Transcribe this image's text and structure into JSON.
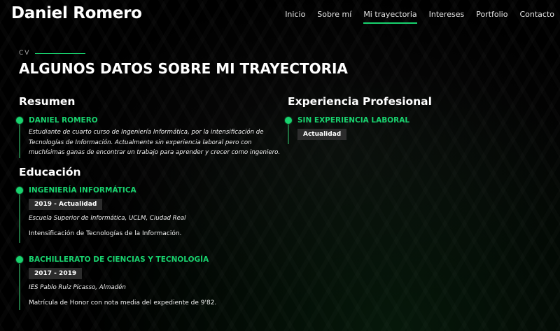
{
  "header": {
    "logo": "Daniel Romero",
    "nav": [
      {
        "label": "Inicio",
        "active": false
      },
      {
        "label": "Sobre mí",
        "active": false
      },
      {
        "label": "Mi trayectoria",
        "active": true
      },
      {
        "label": "Intereses",
        "active": false
      },
      {
        "label": "Portfolio",
        "active": false
      },
      {
        "label": "Contacto",
        "active": false
      }
    ]
  },
  "section": {
    "tag": "CV",
    "title": "ALGUNOS DATOS SOBRE MI TRAYECTORIA"
  },
  "resumen": {
    "heading": "Resumen",
    "item": {
      "title": "DANIEL ROMERO",
      "description": "Estudiante de cuarto curso de Ingeniería Informática, por la intensificación de Tecnologías de Información. Actualmente sin experiencia laboral pero con muchísimas ganas de encontrar un trabajo para aprender y crecer como ingeniero."
    }
  },
  "educacion": {
    "heading": "Educación",
    "items": [
      {
        "title": "INGENIERÍA INFORMÁTICA",
        "date": "2019 - Actualidad",
        "institution": "Escuela Superior de Informática, UCLM, Ciudad Real",
        "detail": "Intensificación de Tecnologías de la Información."
      },
      {
        "title": "BACHILLERATO DE CIENCIAS Y TECNOLOGÍA",
        "date": "2017 - 2019",
        "institution": "IES Pablo Ruiz Picasso, Almadén",
        "detail": "Matrícula de Honor con nota media del expediente de 9'82."
      }
    ]
  },
  "experiencia": {
    "heading": "Experiencia Profesional",
    "item": {
      "title": "SIN EXPERIENCIA LABORAL",
      "date": "Actualidad"
    }
  },
  "colors": {
    "accent": "#18d26e",
    "background": "#000000",
    "date_badge": "#2c2c2c"
  }
}
